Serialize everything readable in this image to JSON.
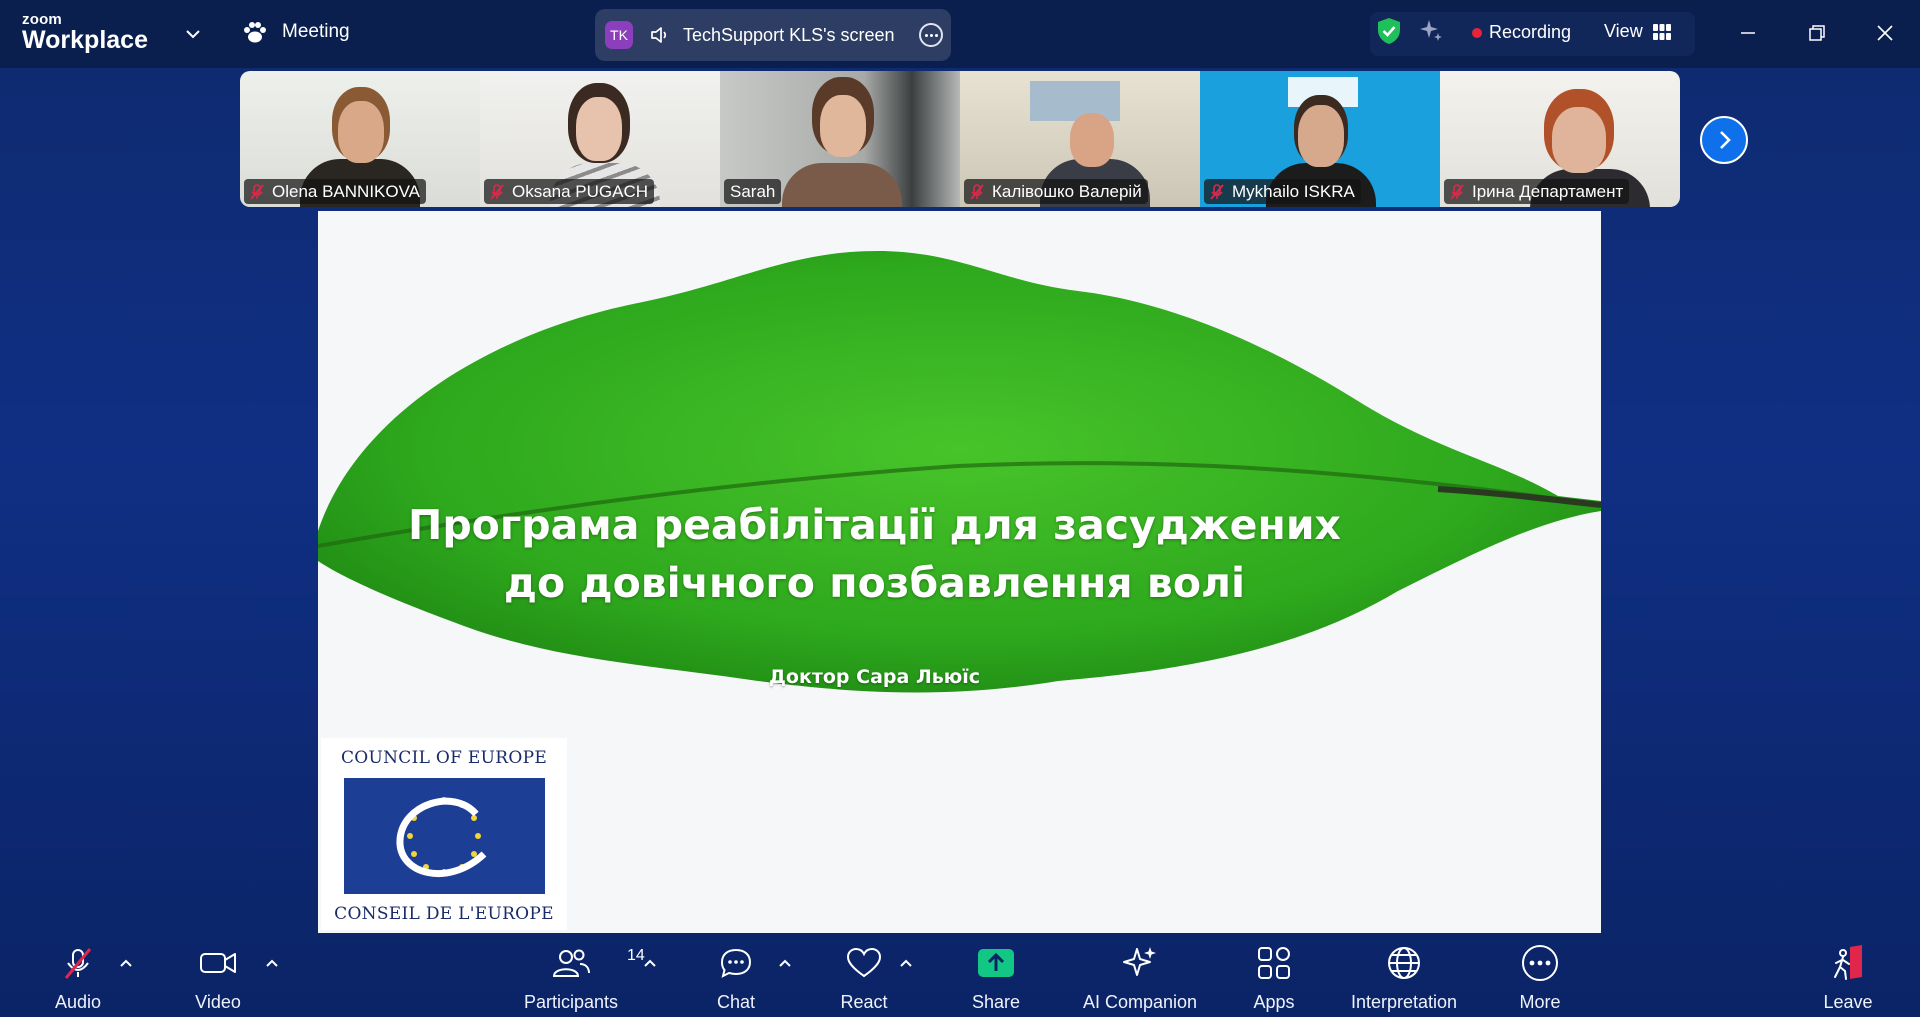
{
  "app": {
    "brand_small": "zoom",
    "brand_big": "Workplace"
  },
  "titlebar": {
    "meeting_label": "Meeting",
    "share_pill": {
      "avatar_initials": "TK",
      "text": "TechSupport KLS's screen"
    },
    "recording_label": "Recording",
    "view_label": "View"
  },
  "participants_strip": [
    {
      "name": "Olena BANNIKOVA",
      "muted": true,
      "active": false
    },
    {
      "name": "Oksana PUGACH",
      "muted": true,
      "active": false
    },
    {
      "name": "Sarah",
      "muted": false,
      "active": true
    },
    {
      "name": "Калівошко Валерій",
      "muted": true,
      "active": false
    },
    {
      "name": "Mykhailo ISKRA",
      "muted": true,
      "active": false
    },
    {
      "name": "Ірина Департамент",
      "muted": true,
      "active": false
    }
  ],
  "slide": {
    "title_line1": "Програма реабілітації для засуджених",
    "title_line2": "до довічного позбавлення волі",
    "author": "Доктор Сара Льюїс",
    "logo_top": "COUNCIL OF EUROPE",
    "logo_bottom": "CONSEIL DE L'EUROPE"
  },
  "toolbar": {
    "audio": "Audio",
    "video": "Video",
    "participants": "Participants",
    "participants_count": "14",
    "chat": "Chat",
    "react": "React",
    "share": "Share",
    "ai_companion": "AI Companion",
    "apps": "Apps",
    "interpretation": "Interpretation",
    "more": "More",
    "leave": "Leave"
  },
  "colors": {
    "titlebar_bg": "#0b1f4f",
    "accent_blue": "#0e71eb",
    "share_green": "#12c784",
    "recording_red": "#e8243a",
    "mute_red": "#e0264a",
    "active_speaker_border": "#2fd597"
  }
}
